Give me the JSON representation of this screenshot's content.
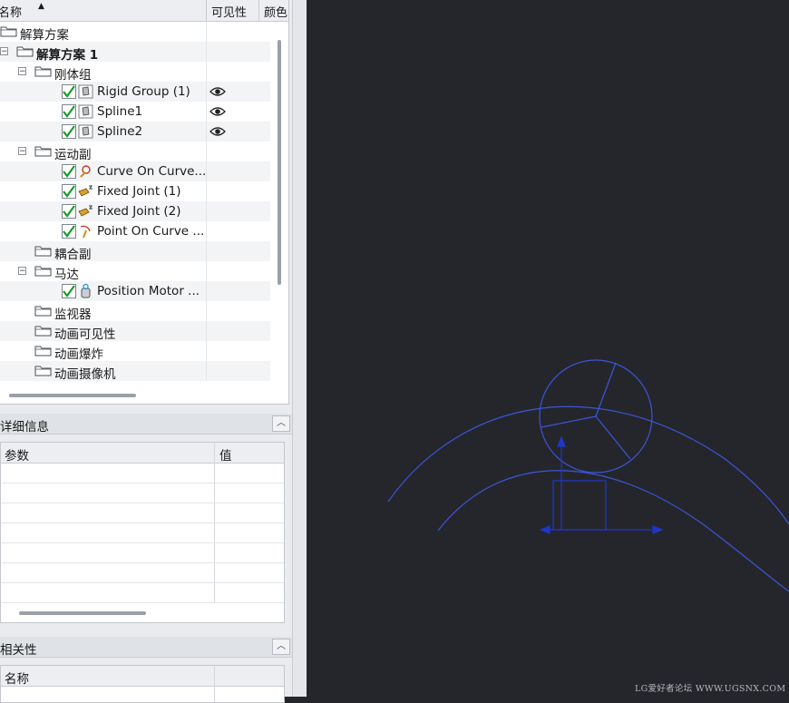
{
  "tree": {
    "columns": {
      "name": "名称",
      "visibility": "可见性",
      "color": "颜色"
    },
    "nodes": [
      {
        "label": "解算方案",
        "depth": 0,
        "toggle": "−",
        "kind": "folder",
        "check": false
      },
      {
        "label": "解算方案 1",
        "depth": 1,
        "toggle": "−",
        "kind": "folder",
        "check": false,
        "bold": true
      },
      {
        "label": "刚体组",
        "depth": 2,
        "toggle": "−",
        "kind": "folder",
        "check": false
      },
      {
        "label": "Rigid Group (1)",
        "depth": 3,
        "kind": "body",
        "check": true,
        "visible": true
      },
      {
        "label": "Spline1",
        "depth": 3,
        "kind": "body",
        "check": true,
        "visible": true
      },
      {
        "label": "Spline2",
        "depth": 3,
        "kind": "body",
        "check": true,
        "visible": true
      },
      {
        "label": "运动副",
        "depth": 2,
        "toggle": "−",
        "kind": "folder",
        "check": false
      },
      {
        "label": "Curve On Curve...",
        "depth": 3,
        "kind": "joint",
        "check": true
      },
      {
        "label": "Fixed Joint (1)",
        "depth": 3,
        "kind": "fixed",
        "check": true
      },
      {
        "label": "Fixed Joint (2)",
        "depth": 3,
        "kind": "fixed",
        "check": true
      },
      {
        "label": "Point On Curve ...",
        "depth": 3,
        "kind": "point",
        "check": true
      },
      {
        "label": "耦合副",
        "depth": 2,
        "kind": "folder",
        "check": false
      },
      {
        "label": "马达",
        "depth": 2,
        "toggle": "−",
        "kind": "folder",
        "check": false
      },
      {
        "label": "Position Motor ...",
        "depth": 3,
        "kind": "motor",
        "check": true
      },
      {
        "label": "监视器",
        "depth": 2,
        "kind": "folder",
        "check": false
      },
      {
        "label": "动画可见性",
        "depth": 2,
        "kind": "folder",
        "check": false
      },
      {
        "label": "动画爆炸",
        "depth": 2,
        "kind": "folder",
        "check": false
      },
      {
        "label": "动画摄像机",
        "depth": 2,
        "kind": "folder",
        "check": false
      }
    ]
  },
  "details": {
    "title": "详细信息",
    "columns": {
      "param": "参数",
      "value": "值"
    }
  },
  "dependencies": {
    "title": "相关性",
    "columns": {
      "name": "名称"
    }
  },
  "colors": {
    "curve": "#3d55d6",
    "accent": "#1f37c8",
    "check": "#1a9b2c"
  },
  "watermark": "LG爱好者论坛 WWW.UGSNX.COM"
}
